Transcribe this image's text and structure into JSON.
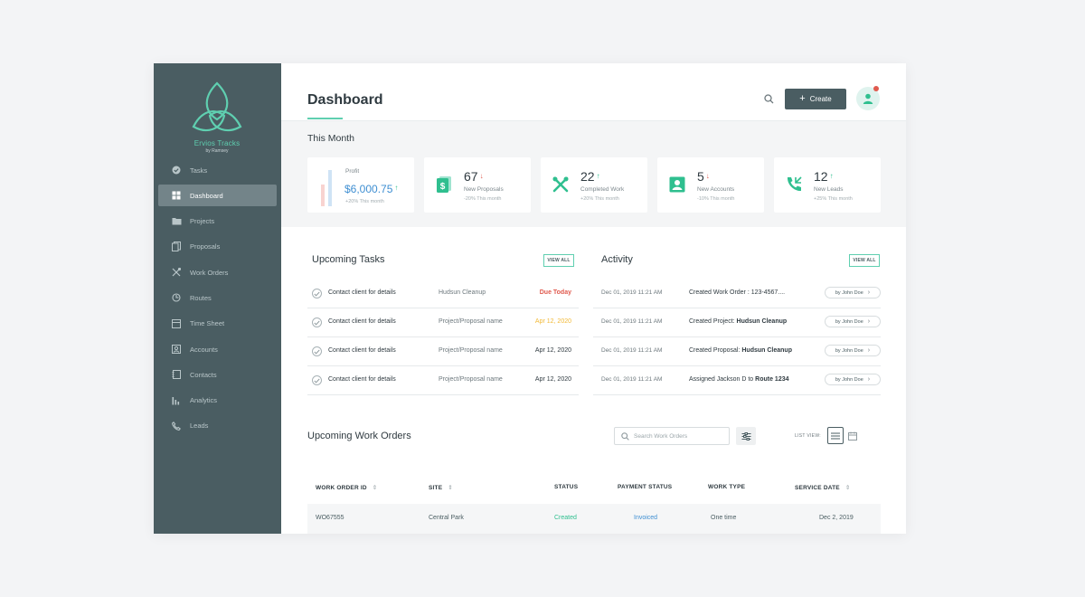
{
  "brand": {
    "name": "Ervios Tracks",
    "sub": "by Ramsey"
  },
  "sidebar": {
    "items": [
      {
        "label": "Tasks",
        "icon": "check-circle-icon",
        "active": false
      },
      {
        "label": "Dashboard",
        "icon": "grid-icon",
        "active": true
      },
      {
        "label": "Projects",
        "icon": "folder-icon",
        "active": false
      },
      {
        "label": "Proposals",
        "icon": "documents-icon",
        "active": false
      },
      {
        "label": "Work Orders",
        "icon": "tools-icon",
        "active": false
      },
      {
        "label": "Routes",
        "icon": "route-icon",
        "active": false
      },
      {
        "label": "Time Sheet",
        "icon": "timesheet-icon",
        "active": false
      },
      {
        "label": "Accounts",
        "icon": "accounts-icon",
        "active": false
      },
      {
        "label": "Contacts",
        "icon": "contacts-icon",
        "active": false
      },
      {
        "label": "Analytics",
        "icon": "bar-chart-icon",
        "active": false
      },
      {
        "label": "Leads",
        "icon": "phone-icon",
        "active": false
      }
    ]
  },
  "header": {
    "title": "Dashboard",
    "create_label": "Create"
  },
  "this_month": {
    "title": "This Month",
    "profit": {
      "label": "Profit",
      "value": "$6,000.75",
      "arrow": "↑",
      "sub": "+20% This month"
    },
    "stats": [
      {
        "value": "67",
        "arrow": "↓",
        "trend": "down",
        "label": "New Proposals",
        "sub": "-20% This month",
        "icon": "proposal-dollar-icon"
      },
      {
        "value": "22",
        "arrow": "↑",
        "trend": "up",
        "label": "Completed Work",
        "sub": "+20% This month",
        "icon": "tools-icon"
      },
      {
        "value": "5",
        "arrow": "↓",
        "trend": "down",
        "label": "New Accounts",
        "sub": "-10% This month",
        "icon": "account-card-icon"
      },
      {
        "value": "12",
        "arrow": "↑",
        "trend": "up",
        "label": "New Leads",
        "sub": "+25% This month",
        "icon": "phone-incoming-icon"
      }
    ]
  },
  "upcoming_tasks": {
    "title": "Upcoming Tasks",
    "view_all": "VIEW ALL",
    "rows": [
      {
        "name": "Contact client for details",
        "project": "Hudsun Cleanup",
        "date": "Due Today",
        "tone": "red"
      },
      {
        "name": "Contact client for details",
        "project": "Project/Proposal name",
        "date": "Apr 12, 2020",
        "tone": "yellow"
      },
      {
        "name": "Contact client for details",
        "project": "Project/Proposal name",
        "date": "Apr 12, 2020",
        "tone": "normal"
      },
      {
        "name": "Contact client for details",
        "project": "Project/Proposal name",
        "date": "Apr 12, 2020",
        "tone": "normal"
      }
    ]
  },
  "activity": {
    "title": "Activity",
    "view_all": "VIEW ALL",
    "rows": [
      {
        "time": "Dec 01, 2019 11:21 AM",
        "prefix": "Created Work Order : 123-4567....",
        "bold": "",
        "by": "by John Doe"
      },
      {
        "time": "Dec 01, 2019 11:21 AM",
        "prefix": "Created Project: ",
        "bold": "Hudsun Cleanup",
        "by": "by John Doe"
      },
      {
        "time": "Dec 01, 2019 11:21 AM",
        "prefix": "Created Proposal: ",
        "bold": "Hudsun Cleanup",
        "by": "by John Doe"
      },
      {
        "time": "Dec 01, 2019 11:21 AM",
        "prefix": "Assigned Jackson D to ",
        "bold": "Route 1234",
        "by": "by John Doe"
      }
    ]
  },
  "work_orders": {
    "title": "Upcoming Work Orders",
    "search_placeholder": "Search Work Orders",
    "list_view_label": "LIST VIEW:",
    "columns": {
      "id": "WORK ORDER ID",
      "site": "SITE",
      "status": "STATUS",
      "payment": "PAYMENT STATUS",
      "type": "WORK TYPE",
      "date": "SERVICE DATE"
    },
    "rows": [
      {
        "id": "WO67555",
        "site": "Central Park",
        "status": "Created",
        "payment": "Invoiced",
        "type": "One time",
        "date": "Dec 2, 2019"
      }
    ]
  },
  "colors": {
    "sidebar": "#4a5d62",
    "accent": "#5fcfb0",
    "blue": "#3f8fd2",
    "red": "#e05a4e",
    "yellow": "#f2b936"
  }
}
